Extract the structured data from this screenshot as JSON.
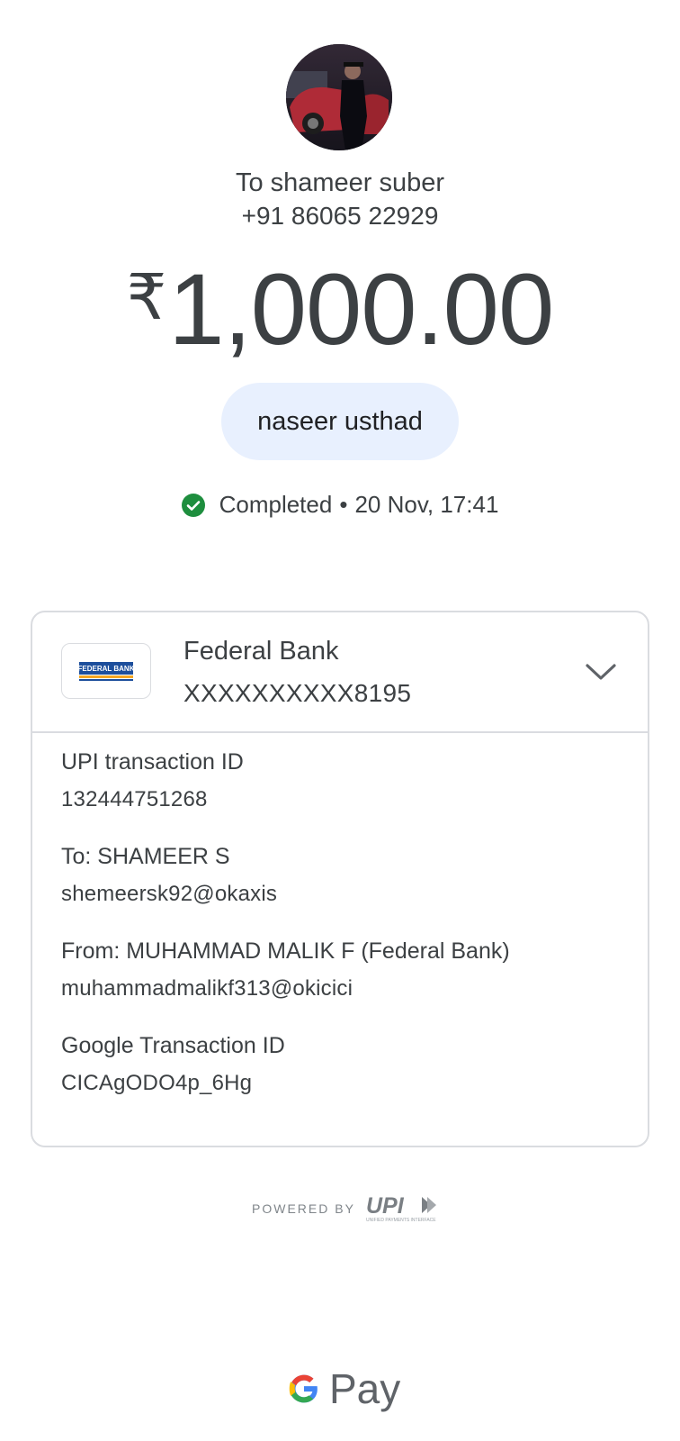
{
  "recipient": {
    "title": "To shameer suber",
    "phone": "+91 86065 22929"
  },
  "payment": {
    "currency_symbol": "₹",
    "amount": "1,000.00",
    "note": "naseer usthad",
    "status": "Completed",
    "separator": "•",
    "datetime": "20 Nov, 17:41",
    "status_color": "#1e8e3e"
  },
  "bank": {
    "name": "Federal Bank",
    "account": "XXXXXXXXXX8195",
    "logo_text": "FEDERAL BANK",
    "logo_colors": [
      "#1d4f9c",
      "#f5a623"
    ]
  },
  "details": [
    {
      "label": "UPI transaction ID",
      "value": "132444751268"
    },
    {
      "label": "To: SHAMEER S",
      "value": "shemeersk92@okaxis"
    },
    {
      "label": "From: MUHAMMAD MALIK F (Federal Bank)",
      "value": "muhammadmalikf313@okicici"
    },
    {
      "label": "Google Transaction ID",
      "value": "CICAgODO4p_6Hg"
    }
  ],
  "footer": {
    "powered_by": "POWERED BY",
    "upi_logo": "UPI",
    "upi_subtitle": "UNIFIED PAYMENTS INTERFACE",
    "brand": "Pay"
  },
  "icons": {
    "status": "check-circle-icon",
    "expand": "chevron-down-icon",
    "google": "google-g-logo"
  }
}
